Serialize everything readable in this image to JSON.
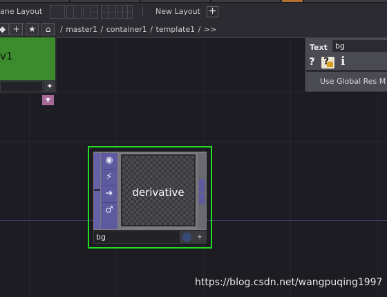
{
  "topbar": {
    "pane_layout_label": "ane Layout",
    "new_layout_label": "New Layout",
    "add_icon": "plus-icon"
  },
  "pathbar": {
    "path": "/ master1 / container1 / template1 / >>",
    "buttons": [
      "back-icon",
      "plus-icon",
      "star-icon",
      "home-icon"
    ]
  },
  "v1_node": {
    "label": "v1",
    "color": "#3c8b2c"
  },
  "param_panel": {
    "op_type": "Text",
    "op_name": "bg",
    "help_glyph": "?",
    "info_glyph": "i",
    "global_res_label": "Use Global Res M"
  },
  "text_node": {
    "viewer_label": "derivative",
    "name": "bg",
    "selected_color": "#22dd22",
    "flag_icons": [
      "viewer-icon",
      "cook-icon",
      "display-icon",
      "bypass-icon"
    ]
  },
  "watermark": "https://blog.csdn.net/wangpuqing1997",
  "colors": {
    "background": "#1c1c22",
    "node_flags": "#5e5aa0",
    "panel": "#4a4a52"
  }
}
